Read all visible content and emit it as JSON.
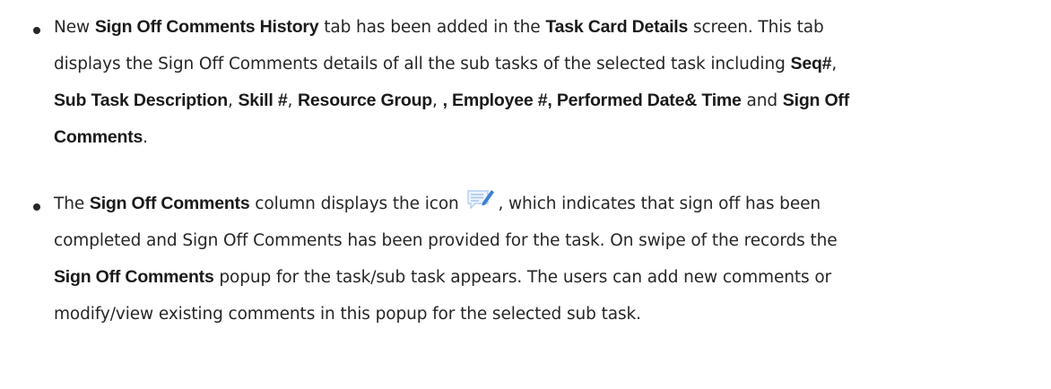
{
  "bullets": [
    {
      "lines": [
        [
          {
            "t": "New ",
            "b": false
          },
          {
            "t": "Sign Off Comments History",
            "b": true
          },
          {
            "t": " tab has been added in the ",
            "b": false
          },
          {
            "t": "Task Card Details",
            "b": true
          },
          {
            "t": " screen. This tab",
            "b": false
          }
        ],
        [
          {
            "t": "displays the Sign Off Comments details of all the sub tasks of the selected task including ",
            "b": false
          },
          {
            "t": "Seq#",
            "b": true
          },
          {
            "t": ",",
            "b": false
          }
        ],
        [
          {
            "t": "Sub Task Description",
            "b": true
          },
          {
            "t": ", ",
            "b": false
          },
          {
            "t": "Skill #",
            "b": true
          },
          {
            "t": ", ",
            "b": false
          },
          {
            "t": "Resource Group",
            "b": true
          },
          {
            "t": ", ",
            "b": false
          },
          {
            "t": ", Employee #, Performed Date& Time",
            "b": true
          },
          {
            "t": " and ",
            "b": false
          },
          {
            "t": "Sign Off",
            "b": true
          }
        ],
        [
          {
            "t": "Comments",
            "b": true
          },
          {
            "t": ".",
            "b": false
          }
        ]
      ]
    },
    {
      "lines": [
        [
          {
            "t": "The ",
            "b": false
          },
          {
            "t": "Sign Off Comments",
            "b": true
          },
          {
            "t": " column displays the icon ",
            "b": false
          },
          {
            "icon": "comment-edit-icon"
          },
          {
            "t": ", which indicates that sign off has been",
            "b": false
          }
        ],
        [
          {
            "t": "completed and Sign Off Comments has been provided for the task. On swipe of the records the",
            "b": false
          }
        ],
        [
          {
            "t": "Sign Off Comments",
            "b": true
          },
          {
            "t": " popup for the task/sub task appears. The users can add new comments or",
            "b": false
          }
        ],
        [
          {
            "t": "modify/view existing comments in this popup for the selected sub task.",
            "b": false
          }
        ]
      ]
    }
  ],
  "colors": {
    "text": "#262626",
    "icon_blue": "#3d7fd6",
    "icon_lines": "#a9c7ef"
  }
}
